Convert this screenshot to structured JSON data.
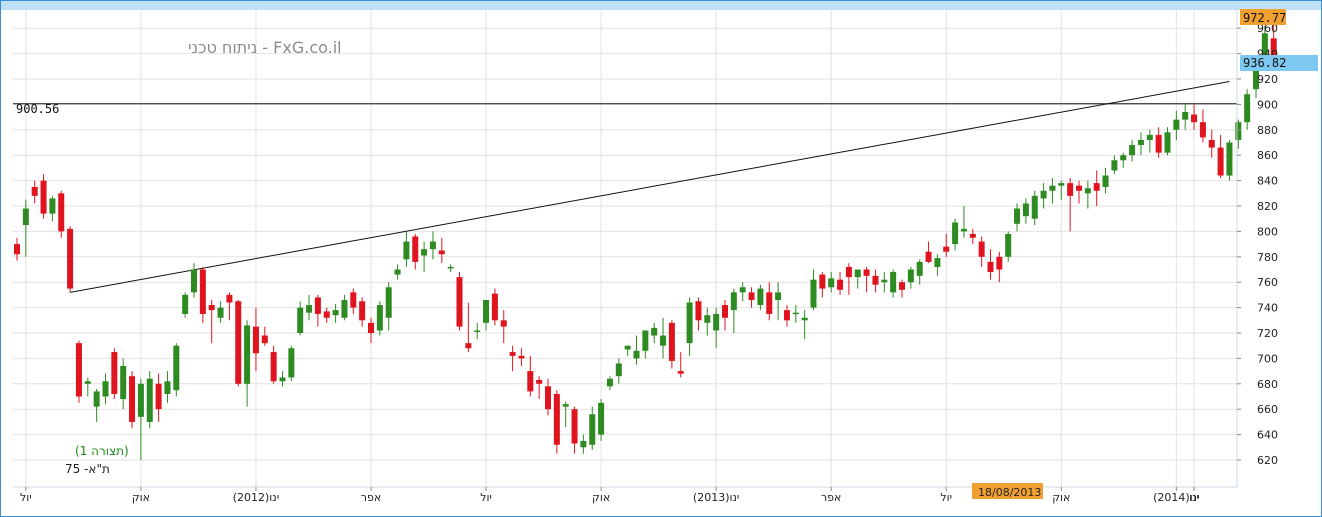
{
  "chart_data": {
    "type": "candlestick",
    "watermark": "FxG.co.il - ניתוח טכני",
    "instrument": "ת\"א- 75",
    "pattern_label": "(תצורה 1)",
    "ylim": [
      608,
      975
    ],
    "y_ticks": [
      620,
      640,
      660,
      680,
      700,
      720,
      740,
      760,
      780,
      800,
      820,
      840,
      860,
      880,
      900,
      920,
      940,
      960
    ],
    "x_labels": [
      {
        "label": "יול",
        "index": 1
      },
      {
        "label": "אוק",
        "index": 14
      },
      {
        "label": "(2012)ינו",
        "index": 27
      },
      {
        "label": "אפר",
        "index": 40
      },
      {
        "label": "יול",
        "index": 53
      },
      {
        "label": "אוק",
        "index": 66
      },
      {
        "label": "(2013)ינו",
        "index": 79
      },
      {
        "label": "אפר",
        "index": 92
      },
      {
        "label": "יול",
        "index": 105
      },
      {
        "label": "אוק",
        "index": 118
      },
      {
        "label": "(2014)ינו",
        "index": 131
      },
      {
        "label": "ינו",
        "index": 133
      }
    ],
    "horizontal_level": {
      "value": 900.56,
      "label": "900.56"
    },
    "trendline": {
      "from": {
        "index": 6,
        "value": 752
      },
      "to": {
        "index": 137,
        "value": 918
      }
    },
    "last_price": {
      "value": "936.82"
    },
    "high_price": {
      "value": "972.77"
    },
    "cursor_date": "18/08/2013",
    "colors": {
      "up": "#2e8b22",
      "down": "#e0141e",
      "accent": "#f0a030",
      "price_tag": "#7cc8f0",
      "frame": "#3c8fd6"
    },
    "candles": [
      [
        790,
        795,
        777,
        782
      ],
      [
        805,
        825,
        780,
        818
      ],
      [
        835,
        840,
        822,
        828
      ],
      [
        840,
        845,
        810,
        814
      ],
      [
        814,
        828,
        808,
        826
      ],
      [
        830,
        832,
        795,
        800
      ],
      [
        802,
        804,
        752,
        755
      ],
      [
        712,
        714,
        665,
        670
      ],
      [
        680,
        685,
        670,
        682
      ],
      [
        662,
        676,
        650,
        674
      ],
      [
        670,
        688,
        664,
        682
      ],
      [
        705,
        708,
        668,
        672
      ],
      [
        668,
        700,
        660,
        694
      ],
      [
        686,
        690,
        645,
        650
      ],
      [
        654,
        684,
        620,
        680
      ],
      [
        650,
        690,
        645,
        684
      ],
      [
        680,
        688,
        650,
        660
      ],
      [
        672,
        690,
        665,
        682
      ],
      [
        675,
        712,
        670,
        710
      ],
      [
        735,
        752,
        732,
        750
      ],
      [
        752,
        775,
        748,
        770
      ],
      [
        770,
        772,
        728,
        735
      ],
      [
        742,
        746,
        712,
        738
      ],
      [
        732,
        745,
        728,
        740
      ],
      [
        750,
        752,
        730,
        744
      ],
      [
        745,
        746,
        678,
        680
      ],
      [
        680,
        730,
        662,
        726
      ],
      [
        725,
        740,
        690,
        704
      ],
      [
        718,
        725,
        710,
        712
      ],
      [
        705,
        710,
        680,
        682
      ],
      [
        682,
        690,
        678,
        685
      ],
      [
        685,
        710,
        682,
        708
      ],
      [
        720,
        745,
        718,
        740
      ],
      [
        736,
        750,
        730,
        742
      ],
      [
        748,
        750,
        725,
        735
      ],
      [
        737,
        740,
        728,
        732
      ],
      [
        734,
        743,
        728,
        738
      ],
      [
        732,
        750,
        730,
        746
      ],
      [
        752,
        755,
        735,
        740
      ],
      [
        745,
        748,
        725,
        730
      ],
      [
        728,
        732,
        712,
        720
      ],
      [
        722,
        745,
        718,
        742
      ],
      [
        732,
        760,
        722,
        756
      ],
      [
        766,
        774,
        762,
        770
      ],
      [
        778,
        800,
        772,
        792
      ],
      [
        796,
        798,
        770,
        776
      ],
      [
        781,
        792,
        768,
        786
      ],
      [
        786,
        800,
        778,
        792
      ],
      [
        785,
        795,
        775,
        782
      ],
      [
        772,
        774,
        768,
        772
      ],
      [
        764,
        768,
        722,
        725
      ],
      [
        712,
        744,
        705,
        708
      ],
      [
        722,
        728,
        715,
        722
      ],
      [
        728,
        746,
        722,
        746
      ],
      [
        751,
        755,
        726,
        730
      ],
      [
        730,
        738,
        712,
        725
      ],
      [
        705,
        710,
        690,
        702
      ],
      [
        702,
        708,
        694,
        700
      ],
      [
        690,
        702,
        670,
        674
      ],
      [
        683,
        686,
        668,
        680
      ],
      [
        678,
        684,
        655,
        660
      ],
      [
        672,
        675,
        625,
        632
      ],
      [
        662,
        666,
        646,
        664
      ],
      [
        660,
        662,
        625,
        633
      ],
      [
        630,
        640,
        625,
        635
      ],
      [
        632,
        662,
        628,
        656
      ],
      [
        640,
        668,
        635,
        665
      ],
      [
        678,
        686,
        675,
        684
      ],
      [
        686,
        700,
        680,
        696
      ],
      [
        707,
        710,
        702,
        710
      ],
      [
        700,
        718,
        695,
        706
      ],
      [
        706,
        722,
        700,
        722
      ],
      [
        718,
        728,
        712,
        724
      ],
      [
        710,
        732,
        700,
        718
      ],
      [
        728,
        730,
        692,
        698
      ],
      [
        690,
        705,
        685,
        688
      ],
      [
        712,
        748,
        702,
        744
      ],
      [
        745,
        748,
        722,
        730
      ],
      [
        728,
        740,
        718,
        734
      ],
      [
        722,
        740,
        708,
        735
      ],
      [
        742,
        746,
        722,
        732
      ],
      [
        738,
        755,
        720,
        752
      ],
      [
        752,
        760,
        745,
        756
      ],
      [
        752,
        756,
        740,
        746
      ],
      [
        742,
        758,
        738,
        755
      ],
      [
        752,
        760,
        730,
        735
      ],
      [
        746,
        760,
        730,
        752
      ],
      [
        738,
        742,
        725,
        730
      ],
      [
        735,
        742,
        728,
        736
      ],
      [
        730,
        738,
        715,
        732
      ],
      [
        740,
        770,
        738,
        762
      ],
      [
        766,
        768,
        748,
        755
      ],
      [
        756,
        768,
        752,
        763
      ],
      [
        762,
        768,
        750,
        754
      ],
      [
        772,
        775,
        750,
        764
      ],
      [
        764,
        770,
        755,
        770
      ],
      [
        770,
        772,
        752,
        765
      ],
      [
        765,
        770,
        752,
        758
      ],
      [
        760,
        768,
        752,
        762
      ],
      [
        752,
        770,
        748,
        768
      ],
      [
        760,
        762,
        748,
        754
      ],
      [
        760,
        772,
        755,
        770
      ],
      [
        765,
        778,
        758,
        776
      ],
      [
        784,
        792,
        775,
        776
      ],
      [
        772,
        782,
        765,
        779
      ],
      [
        788,
        798,
        780,
        784
      ],
      [
        790,
        810,
        785,
        807
      ],
      [
        800,
        820,
        795,
        802
      ],
      [
        798,
        802,
        790,
        795
      ],
      [
        792,
        796,
        772,
        780
      ],
      [
        776,
        786,
        762,
        768
      ],
      [
        780,
        784,
        760,
        770
      ],
      [
        780,
        800,
        776,
        798
      ],
      [
        806,
        822,
        800,
        818
      ],
      [
        812,
        826,
        806,
        822
      ],
      [
        810,
        832,
        805,
        828
      ],
      [
        826,
        838,
        818,
        832
      ],
      [
        832,
        842,
        822,
        836
      ],
      [
        836,
        840,
        825,
        838
      ],
      [
        838,
        842,
        800,
        828
      ],
      [
        836,
        840,
        822,
        832
      ],
      [
        830,
        840,
        818,
        834
      ],
      [
        838,
        848,
        820,
        832
      ],
      [
        835,
        850,
        830,
        844
      ],
      [
        848,
        860,
        845,
        856
      ],
      [
        856,
        862,
        850,
        860
      ],
      [
        860,
        872,
        855,
        868
      ],
      [
        868,
        878,
        860,
        872
      ],
      [
        872,
        880,
        862,
        876
      ],
      [
        876,
        882,
        858,
        862
      ],
      [
        862,
        882,
        860,
        878
      ],
      [
        880,
        895,
        872,
        888
      ],
      [
        888,
        900,
        880,
        894
      ],
      [
        892,
        900,
        880,
        886
      ],
      [
        886,
        896,
        870,
        874
      ],
      [
        872,
        880,
        858,
        866
      ],
      [
        866,
        876,
        842,
        844
      ],
      [
        844,
        872,
        840,
        870
      ],
      [
        872,
        888,
        865,
        886
      ],
      [
        886,
        912,
        880,
        908
      ],
      [
        912,
        938,
        905,
        932
      ],
      [
        935,
        962,
        930,
        956
      ],
      [
        952,
        968,
        928,
        936
      ]
    ]
  }
}
